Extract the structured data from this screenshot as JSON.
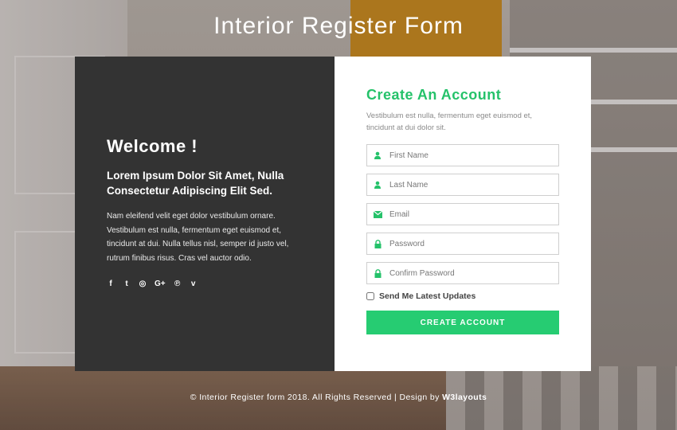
{
  "page": {
    "title": "Interior Register Form"
  },
  "left": {
    "welcome": "Welcome !",
    "subheading": "Lorem Ipsum Dolor Sit Amet, Nulla Consectetur Adipiscing Elit Sed.",
    "description": "Nam eleifend velit eget dolor vestibulum ornare. Vestibulum est nulla, fermentum eget euismod et, tincidunt at dui. Nulla tellus nisl, semper id justo vel, rutrum finibus risus. Cras vel auctor odio.",
    "social": [
      {
        "name": "facebook-icon",
        "glyph": "f"
      },
      {
        "name": "twitter-icon",
        "glyph": "t"
      },
      {
        "name": "instagram-icon",
        "glyph": "◎"
      },
      {
        "name": "google-plus-icon",
        "glyph": "G+"
      },
      {
        "name": "pinterest-icon",
        "glyph": "℗"
      },
      {
        "name": "vimeo-icon",
        "glyph": "v"
      }
    ]
  },
  "form": {
    "title": "Create An Account",
    "description": "Vestibulum est nulla, fermentum eget euismod et, tincidunt at dui dolor sit.",
    "fields": [
      {
        "placeholder": "First Name",
        "icon": "user-icon"
      },
      {
        "placeholder": "Last Name",
        "icon": "user-icon"
      },
      {
        "placeholder": "Email",
        "icon": "envelope-icon"
      },
      {
        "placeholder": "Password",
        "icon": "lock-icon"
      },
      {
        "placeholder": "Confirm Password",
        "icon": "lock-icon"
      }
    ],
    "checkbox_label": "Send Me Latest Updates",
    "submit_label": "CREATE ACCOUNT"
  },
  "footer": {
    "text": "© Interior Register form 2018. All Rights Reserved | Design by",
    "brand": "W3layouts"
  },
  "colors": {
    "accent": "#26cc72",
    "panel_dark": "#333333"
  }
}
